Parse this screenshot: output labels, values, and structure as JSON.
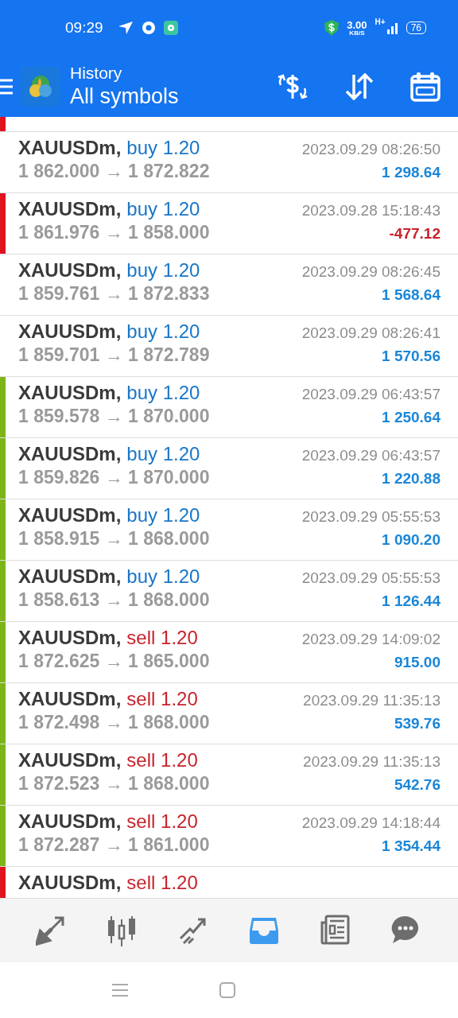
{
  "status_bar": {
    "time": "09:29",
    "speed": "3.00",
    "speed_unit": "KB/S",
    "network": "H+",
    "battery": "76"
  },
  "header": {
    "title": "History",
    "subtitle": "All symbols"
  },
  "top_partial_row": {
    "color": "#e0141e"
  },
  "deals": [
    {
      "symbol": "XAUUSDm,",
      "kind": "buy",
      "trade": "buy 1.20",
      "prices": "1 862.000 → 1 872.822",
      "time": "2023.09.29 08:26:50",
      "profit": "1 298.64",
      "loss": false
    },
    {
      "symbol": "XAUUSDm,",
      "kind": "buy",
      "trade": "buy 1.20",
      "prices": "1 861.976 → 1 858.000",
      "time": "2023.09.28 15:18:43",
      "profit": "-477.12",
      "loss": true,
      "color": "#e0141e"
    },
    {
      "symbol": "XAUUSDm,",
      "kind": "buy",
      "trade": "buy 1.20",
      "prices": "1 859.761 → 1 872.833",
      "time": "2023.09.29 08:26:45",
      "profit": "1 568.64",
      "loss": false
    },
    {
      "symbol": "XAUUSDm,",
      "kind": "buy",
      "trade": "buy 1.20",
      "prices": "1 859.701 → 1 872.789",
      "time": "2023.09.29 08:26:41",
      "profit": "1 570.56",
      "loss": false
    },
    {
      "symbol": "XAUUSDm,",
      "kind": "buy",
      "trade": "buy 1.20",
      "prices": "1 859.578 → 1 870.000",
      "time": "2023.09.29 06:43:57",
      "profit": "1 250.64",
      "loss": false,
      "color": "#7cb518"
    },
    {
      "symbol": "XAUUSDm,",
      "kind": "buy",
      "trade": "buy 1.20",
      "prices": "1 859.826 → 1 870.000",
      "time": "2023.09.29 06:43:57",
      "profit": "1 220.88",
      "loss": false,
      "color": "#7cb518"
    },
    {
      "symbol": "XAUUSDm,",
      "kind": "buy",
      "trade": "buy 1.20",
      "prices": "1 858.915 → 1 868.000",
      "time": "2023.09.29 05:55:53",
      "profit": "1 090.20",
      "loss": false,
      "color": "#7cb518"
    },
    {
      "symbol": "XAUUSDm,",
      "kind": "buy",
      "trade": "buy 1.20",
      "prices": "1 858.613 → 1 868.000",
      "time": "2023.09.29 05:55:53",
      "profit": "1 126.44",
      "loss": false,
      "color": "#7cb518"
    },
    {
      "symbol": "XAUUSDm,",
      "kind": "sell",
      "trade": "sell 1.20",
      "prices": "1 872.625 → 1 865.000",
      "time": "2023.09.29 14:09:02",
      "profit": "915.00",
      "loss": false,
      "color": "#7cb518"
    },
    {
      "symbol": "XAUUSDm,",
      "kind": "sell",
      "trade": "sell 1.20",
      "prices": "1 872.498 → 1 868.000",
      "time": "2023.09.29 11:35:13",
      "profit": "539.76",
      "loss": false,
      "color": "#7cb518"
    },
    {
      "symbol": "XAUUSDm,",
      "kind": "sell",
      "trade": "sell 1.20",
      "prices": "1 872.523 → 1 868.000",
      "time": "2023.09.29 11:35:13",
      "profit": "542.76",
      "loss": false,
      "color": "#7cb518"
    },
    {
      "symbol": "XAUUSDm,",
      "kind": "sell",
      "trade": "sell 1.20",
      "prices": "1 872.287 → 1 861.000",
      "time": "2023.09.29 14:18:44",
      "profit": "1 354.44",
      "loss": false,
      "color": "#7cb518"
    },
    {
      "symbol": "XAUUSDm,",
      "kind": "sell",
      "trade": "sell 1.20",
      "color": "#e0141e"
    }
  ],
  "bottom_nav": [
    {
      "kind": "trade",
      "selected": false
    },
    {
      "kind": "quotes",
      "selected": false
    },
    {
      "kind": "chart",
      "selected": false
    },
    {
      "kind": "history",
      "selected": true
    },
    {
      "kind": "news",
      "selected": false
    },
    {
      "kind": "chat",
      "selected": false
    }
  ],
  "system_nav": [
    {
      "kind": "recents"
    },
    {
      "kind": "home"
    }
  ]
}
